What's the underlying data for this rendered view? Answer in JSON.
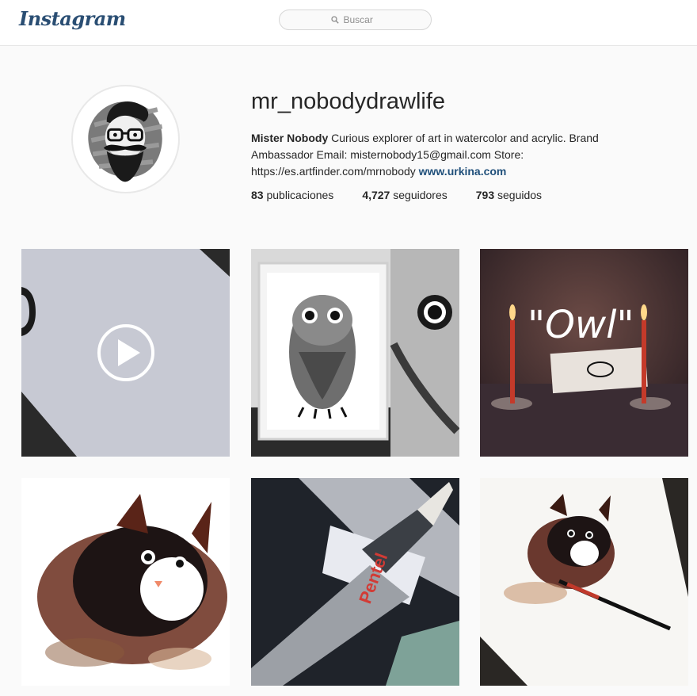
{
  "header": {
    "logo": "Instagram",
    "search_placeholder": "Buscar"
  },
  "profile": {
    "username": "mr_nobodydrawlife",
    "full_name": "Mister Nobody",
    "bio": "Curious explorer of art in watercolor and acrylic. Brand Ambassador Email: misternobody15@gmail.com Store: https://es.artfinder.com/mrnobody",
    "website": "www.urkina.com",
    "stats": {
      "posts_count": "83",
      "posts_label": "publicaciones",
      "followers_count": "4,727",
      "followers_label": "seguidores",
      "following_count": "793",
      "following_label": "seguidos"
    }
  },
  "posts": [
    {
      "kind": "video",
      "icon": "play-icon"
    },
    {
      "kind": "image",
      "subject": "owl watercolor painting"
    },
    {
      "kind": "image",
      "caption_text": "\"Owl\""
    },
    {
      "kind": "image",
      "subject": "cat watercolor painting"
    },
    {
      "kind": "image",
      "subject": "brush pen"
    },
    {
      "kind": "image",
      "subject": "cat painting with brush"
    }
  ],
  "colors": {
    "link": "#1f4f7a",
    "logo": "#2a4e73"
  }
}
